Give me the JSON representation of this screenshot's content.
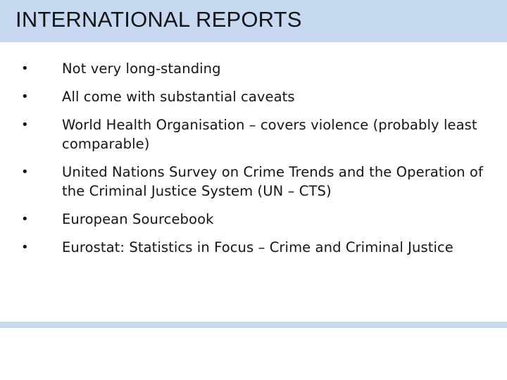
{
  "slide": {
    "title": "INTERNATIONAL REPORTS",
    "bullet_symbol": "•",
    "bullets": [
      "Not very long-standing",
      "All come with substantial caveats",
      "World Health Organisation – covers violence (probably least comparable)",
      "United Nations Survey on Crime Trends and the Operation of the Criminal Justice System (UN – CTS)",
      "European Sourcebook",
      "Eurostat: Statistics in Focus – Crime and Criminal Justice"
    ]
  },
  "colors": {
    "title_band": "#c6d9f0",
    "text": "#141414",
    "background": "#ffffff"
  }
}
